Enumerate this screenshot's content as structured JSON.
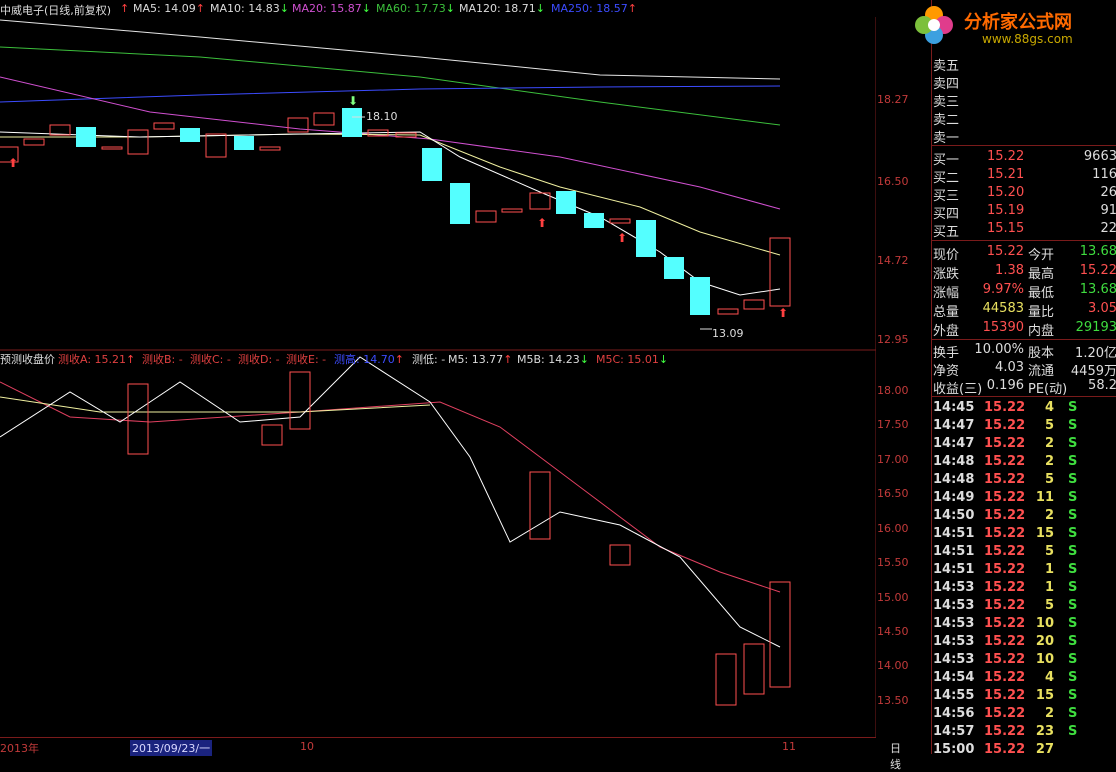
{
  "chart_title": "中威电子(日线,前复权)",
  "ma_labels": [
    {
      "text": "MA5: 14.09",
      "color": "#dcdcdc",
      "arrow": "↑"
    },
    {
      "text": "MA10: 14.83",
      "color": "#dcdcdc",
      "arrow": "↓"
    },
    {
      "text": "MA20: 15.87",
      "color": "#d050d0",
      "arrow": "↓"
    },
    {
      "text": "MA60: 17.73",
      "color": "#3cbf3c",
      "arrow": "↓"
    },
    {
      "text": "MA120: 18.71",
      "color": "#dcdcdc",
      "arrow": "↓"
    },
    {
      "text": "MA250: 18.57",
      "color": "#3c4cff",
      "arrow": "↑"
    }
  ],
  "price_axis": [
    "18.27",
    "16.50",
    "14.72",
    "12.95"
  ],
  "indicator_axis": [
    "18.00",
    "17.50",
    "17.00",
    "16.50",
    "16.00",
    "15.50",
    "15.00",
    "14.50",
    "14.00",
    "13.50"
  ],
  "indicator_title": "预测收盘价",
  "indicator_labels": [
    {
      "text": "测收A: 15.21",
      "color": "#e04040",
      "arrow": "↑"
    },
    {
      "text": "测收B: -",
      "color": "#e04040",
      "arrow": ""
    },
    {
      "text": "测收C: -",
      "color": "#e04040",
      "arrow": ""
    },
    {
      "text": "测收D: -",
      "color": "#e04040",
      "arrow": ""
    },
    {
      "text": "测收E: -",
      "color": "#e04040",
      "arrow": ""
    },
    {
      "text": "测高: 14.70",
      "color": "#3c4cff",
      "arrow": "↑"
    },
    {
      "text": "测低: -",
      "color": "#dcdcdc",
      "arrow": ""
    },
    {
      "text": "M5: 13.77",
      "color": "#dcdcdc",
      "arrow": "↑"
    },
    {
      "text": "M5B: 14.23",
      "color": "#dcdcdc",
      "arrow": "↓"
    },
    {
      "text": "M5C: 15.01",
      "color": "#e04040",
      "arrow": "↓"
    }
  ],
  "annotations": {
    "high": "18.10",
    "low": "13.09"
  },
  "bottom_axis": {
    "year": "2013年",
    "date": "2013/09/23/一",
    "m10": "10",
    "m11": "11",
    "period": "日线"
  },
  "watermark": {
    "site": "分析家公式网",
    "url": "www.88gs.com"
  },
  "order_book": {
    "sells": [
      {
        "label": "卖五"
      },
      {
        "label": "卖四"
      },
      {
        "label": "卖三"
      },
      {
        "label": "卖二"
      },
      {
        "label": "卖一"
      }
    ],
    "buys": [
      {
        "label": "买一",
        "price": "15.22",
        "vol": "9663"
      },
      {
        "label": "买二",
        "price": "15.21",
        "vol": "116"
      },
      {
        "label": "买三",
        "price": "15.20",
        "vol": "26"
      },
      {
        "label": "买四",
        "price": "15.19",
        "vol": "91"
      },
      {
        "label": "买五",
        "price": "15.15",
        "vol": "22"
      }
    ]
  },
  "quote": [
    {
      "l1": "现价",
      "v1": "15.22",
      "c1": "#ff5050",
      "l2": "今开",
      "v2": "13.68",
      "c2": "#3fdc3f"
    },
    {
      "l1": "涨跌",
      "v1": "1.38",
      "c1": "#ff5050",
      "l2": "最高",
      "v2": "15.22",
      "c2": "#ff5050"
    },
    {
      "l1": "涨幅",
      "v1": "9.97%",
      "c1": "#ff5050",
      "l2": "最低",
      "v2": "13.68",
      "c2": "#3fdc3f"
    },
    {
      "l1": "总量",
      "v1": "44583",
      "c1": "#e8e060",
      "l2": "量比",
      "v2": "3.05",
      "c2": "#ff5050"
    },
    {
      "l1": "外盘",
      "v1": "15390",
      "c1": "#ff5050",
      "l2": "内盘",
      "v2": "29193",
      "c2": "#3fdc3f"
    }
  ],
  "fundamentals": [
    {
      "l1": "换手",
      "v1": "10.00%",
      "l2": "股本",
      "v2": "1.20亿"
    },
    {
      "l1": "净资",
      "v1": "4.03",
      "l2": "流通",
      "v2": "4459万"
    },
    {
      "l1": "收益(三)",
      "v1": "0.196",
      "l2": "PE(动)",
      "v2": "58.2"
    }
  ],
  "ticks": [
    {
      "time": "14:45",
      "price": "15.22",
      "vol": "4",
      "side": "S"
    },
    {
      "time": "14:47",
      "price": "15.22",
      "vol": "5",
      "side": "S"
    },
    {
      "time": "14:47",
      "price": "15.22",
      "vol": "2",
      "side": "S"
    },
    {
      "time": "14:48",
      "price": "15.22",
      "vol": "2",
      "side": "S"
    },
    {
      "time": "14:48",
      "price": "15.22",
      "vol": "5",
      "side": "S"
    },
    {
      "time": "14:49",
      "price": "15.22",
      "vol": "11",
      "side": "S"
    },
    {
      "time": "14:50",
      "price": "15.22",
      "vol": "2",
      "side": "S"
    },
    {
      "time": "14:51",
      "price": "15.22",
      "vol": "15",
      "side": "S"
    },
    {
      "time": "14:51",
      "price": "15.22",
      "vol": "5",
      "side": "S"
    },
    {
      "time": "14:51",
      "price": "15.22",
      "vol": "1",
      "side": "S"
    },
    {
      "time": "14:53",
      "price": "15.22",
      "vol": "1",
      "side": "S"
    },
    {
      "time": "14:53",
      "price": "15.22",
      "vol": "5",
      "side": "S"
    },
    {
      "time": "14:53",
      "price": "15.22",
      "vol": "10",
      "side": "S"
    },
    {
      "time": "14:53",
      "price": "15.22",
      "vol": "20",
      "side": "S"
    },
    {
      "time": "14:53",
      "price": "15.22",
      "vol": "10",
      "side": "S"
    },
    {
      "time": "14:54",
      "price": "15.22",
      "vol": "4",
      "side": "S"
    },
    {
      "time": "14:55",
      "price": "15.22",
      "vol": "15",
      "side": "S"
    },
    {
      "time": "14:56",
      "price": "15.22",
      "vol": "2",
      "side": "S"
    },
    {
      "time": "14:57",
      "price": "15.22",
      "vol": "23",
      "side": "S"
    },
    {
      "time": "15:00",
      "price": "15.22",
      "vol": "27",
      "side": ""
    }
  ]
}
